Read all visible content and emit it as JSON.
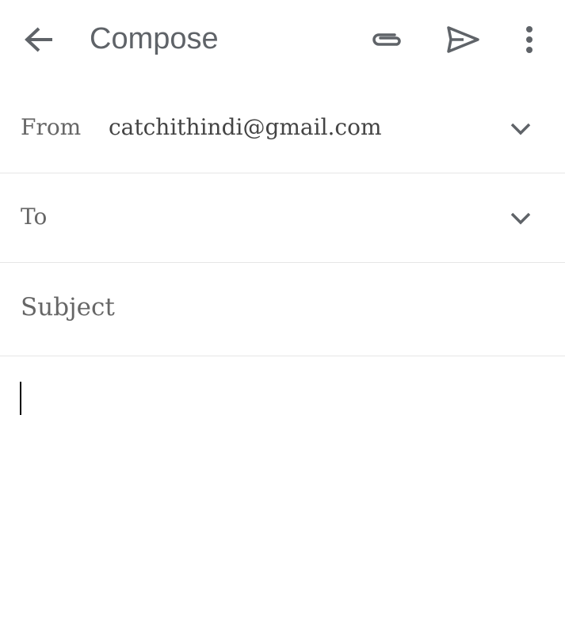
{
  "header": {
    "title": "Compose",
    "back_icon": "arrow-back-icon",
    "attach_icon": "paperclip-icon",
    "send_icon": "send-icon",
    "more_icon": "more-vert-icon"
  },
  "from": {
    "label": "From",
    "value": "catchithindi@gmail.com"
  },
  "to": {
    "label": "To",
    "value": ""
  },
  "subject": {
    "placeholder": "Subject"
  },
  "body": {
    "value": ""
  }
}
